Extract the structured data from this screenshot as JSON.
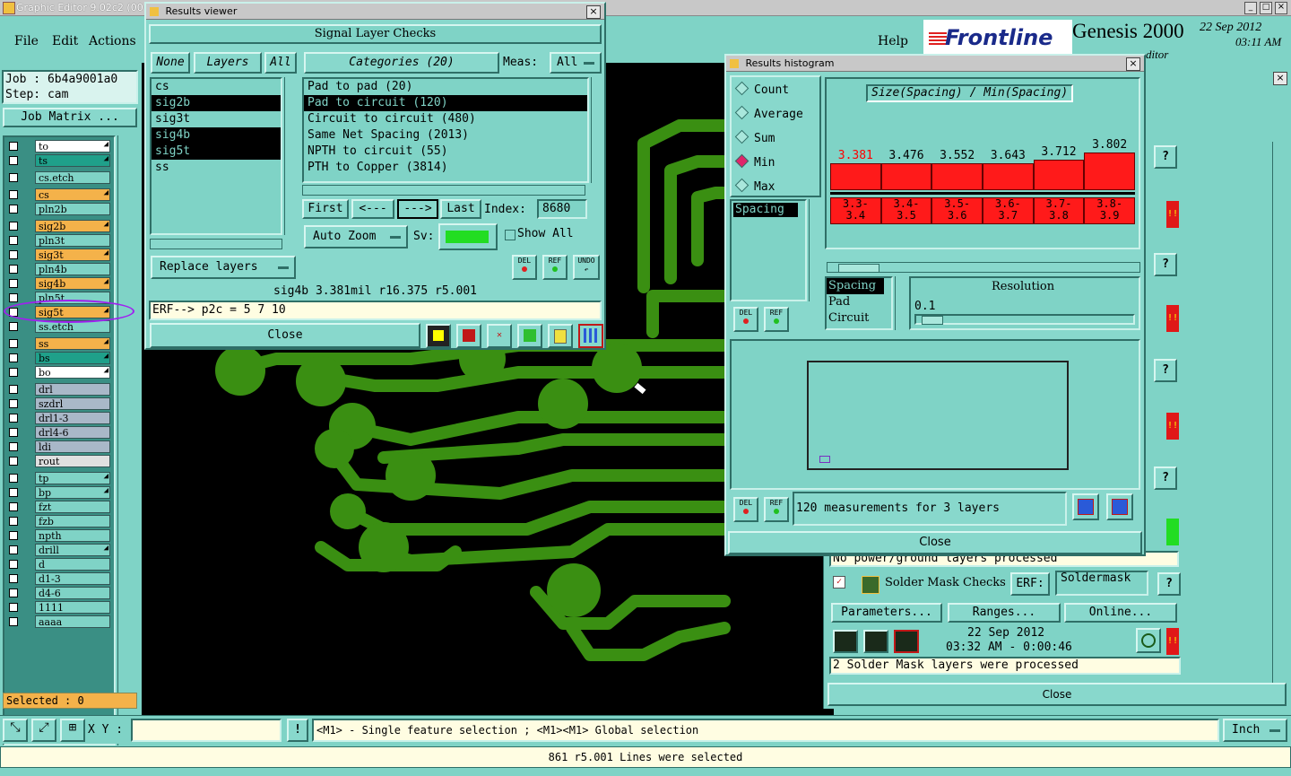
{
  "app": {
    "window_title": "Graphic Editor 9.02c2 (00",
    "menu": [
      "File",
      "Edit",
      "Actions"
    ],
    "help": "Help",
    "brand": "Frontline",
    "product": "Genesis 2000",
    "date": "22 Sep 2012",
    "time": "03:11 AM",
    "editor_fragment": "ditor"
  },
  "job": {
    "label": "Job : 6b4a9001a0",
    "step": "Step: cam",
    "matrix_button": "Job Matrix ..."
  },
  "layers": [
    {
      "name": "to",
      "color": "#ffffff",
      "mark": true
    },
    {
      "name": "ts",
      "color": "#1fa08a",
      "mark": true
    },
    {
      "name": "cs.etch",
      "color": "#7fd3c6",
      "mark": false
    },
    {
      "name": "cs",
      "color": "#f4b24a",
      "mark": true
    },
    {
      "name": "pln2b",
      "color": "#7fd3c6",
      "mark": false
    },
    {
      "name": "sig2b",
      "color": "#f4b24a",
      "mark": true
    },
    {
      "name": "pln3t",
      "color": "#7fd3c6",
      "mark": false
    },
    {
      "name": "sig3t",
      "color": "#f4b24a",
      "mark": true
    },
    {
      "name": "pln4b",
      "color": "#7fd3c6",
      "mark": false
    },
    {
      "name": "sig4b",
      "color": "#f4b24a",
      "mark": true
    },
    {
      "name": "pln5t",
      "color": "#7fd3c6",
      "mark": false
    },
    {
      "name": "sig5t",
      "color": "#f4b24a",
      "mark": true
    },
    {
      "name": "ss.etch",
      "color": "#7fd3c6",
      "mark": false
    },
    {
      "name": "ss",
      "color": "#f4b24a",
      "mark": true
    },
    {
      "name": "bs",
      "color": "#1fa08a",
      "mark": true
    },
    {
      "name": "bo",
      "color": "#ffffff",
      "mark": true
    },
    {
      "name": "drl",
      "color": "#a9b8c8",
      "mark": false
    },
    {
      "name": "szdrl",
      "color": "#a9b8c8",
      "mark": false
    },
    {
      "name": "drl1-3",
      "color": "#a9b8c8",
      "mark": false
    },
    {
      "name": "drl4-6",
      "color": "#a9b8c8",
      "mark": false
    },
    {
      "name": "ldi",
      "color": "#a9b8c8",
      "mark": false
    },
    {
      "name": "rout",
      "color": "#e0e0e0",
      "mark": false
    },
    {
      "name": "tp",
      "color": "#7fd3c6",
      "mark": true
    },
    {
      "name": "bp",
      "color": "#7fd3c6",
      "mark": true
    },
    {
      "name": "fzt",
      "color": "#7fd3c6",
      "mark": false
    },
    {
      "name": "fzb",
      "color": "#7fd3c6",
      "mark": false
    },
    {
      "name": "npth",
      "color": "#7fd3c6",
      "mark": false
    },
    {
      "name": "drill",
      "color": "#7fd3c6",
      "mark": true
    },
    {
      "name": "d",
      "color": "#7fd3c6",
      "mark": false
    },
    {
      "name": "d1-3",
      "color": "#7fd3c6",
      "mark": false
    },
    {
      "name": "d4-6",
      "color": "#7fd3c6",
      "mark": false
    },
    {
      "name": "1111",
      "color": "#7fd3c6",
      "mark": false
    },
    {
      "name": "aaaa",
      "color": "#7fd3c6",
      "mark": false
    }
  ],
  "selected": "Selected : 0",
  "bottom": {
    "xy_label": "X Y :",
    "hint": "<M1> - Single feature selection ; <M1><M1> Global selection",
    "unit": "Inch",
    "status": "861 r5.001 Lines were selected"
  },
  "results_viewer": {
    "title": "Results viewer",
    "header": "Signal Layer Checks",
    "none": "None",
    "layers": "Layers",
    "all": "All",
    "categories": "Categories (20)",
    "meas_label": "Meas:",
    "meas_value": "All",
    "layer_list": [
      "cs",
      "sig2b",
      "sig3t",
      "sig4b",
      "sig5t",
      "ss"
    ],
    "category_list": [
      "Pad to pad (20)",
      "Pad to circuit (120)",
      "Circuit to circuit (480)",
      "Same Net Spacing (2013)",
      "NPTH to circuit (55)",
      "PTH to Copper (3814)"
    ],
    "first": "First",
    "prev": "<---",
    "next": "--->",
    "last": "Last",
    "index_label": "Index:",
    "index_value": "8680",
    "auto_zoom": "Auto Zoom",
    "sv_label": "Sv:",
    "show_all": "Show All",
    "replace_layers": "Replace layers",
    "del": "DEL",
    "ref": "REF",
    "undo": "UNDO",
    "info": "sig4b 3.381mil  r16.375  r5.001",
    "erf": "ERF--> p2c = 5 7 10",
    "close": "Close"
  },
  "histogram": {
    "title": "Results histogram",
    "options": [
      "Count",
      "Average",
      "Sum",
      "Min",
      "Max"
    ],
    "selected_option": "Min",
    "chart_title": "Size(Spacing) / Min(Spacing)",
    "list_item": "Spacing",
    "types": [
      "Spacing",
      "Pad",
      "Circuit"
    ],
    "resolution_label": "Resolution",
    "resolution_value": "0.1",
    "del": "DEL",
    "ref": "REF",
    "summary": "120 measurements for 3 layers",
    "close": "Close"
  },
  "chart_data": {
    "type": "bar",
    "title": "Size(Spacing) / Min(Spacing)",
    "categories": [
      "3.3-3.4",
      "3.4-3.5",
      "3.5-3.6",
      "3.6-3.7",
      "3.7-3.8",
      "3.8-3.9"
    ],
    "values": [
      3.381,
      3.476,
      3.552,
      3.643,
      3.712,
      3.802
    ],
    "value_labels": [
      "3.381",
      "3.476",
      "3.552",
      "3.643",
      "3.712",
      "3.802"
    ],
    "tick_labels_top": [
      "3.3-",
      "3.4-",
      "3.5-",
      "3.6-",
      "3.7-",
      "3.8-"
    ],
    "tick_labels_bottom": [
      "3.4",
      "3.5",
      "3.6",
      "3.7",
      "3.8",
      "3.9"
    ],
    "colors": {
      "bar": "#ff1a1a",
      "first_label": "#ff0000"
    }
  },
  "checklist": {
    "no_power": "No power/ground layers processed",
    "solder_title": "Solder Mask Checks",
    "erf_label": "ERF:",
    "erf_value": "Soldermask",
    "params": "Parameters...",
    "ranges": "Ranges...",
    "online": "Online...",
    "run_date": "22 Sep 2012",
    "run_time": "03:32 AM - 0:00:46",
    "processed": "2 Solder Mask layers were processed",
    "close": "Close",
    "help": "?",
    "alert": "!!"
  }
}
